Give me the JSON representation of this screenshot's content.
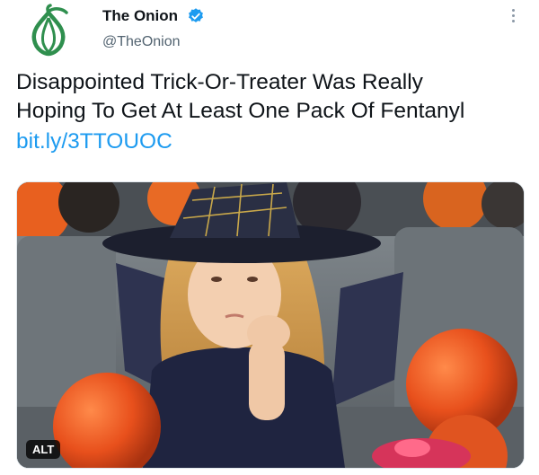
{
  "account": {
    "display_name": "The Onion",
    "handle": "@TheOnion",
    "verified": true,
    "avatar_icon": "onion-logo-icon",
    "brand_color": "#2f8f4e"
  },
  "tweet": {
    "text_lines": [
      "Disappointed Trick-Or-Treater Was Really",
      "Hoping To Get At Least One Pack Of Fentanyl"
    ],
    "link": "bit.ly/3TTOUOC"
  },
  "media": {
    "alt_label": "ALT"
  },
  "colors": {
    "link": "#1d9bf0",
    "verified": "#1d9bf0",
    "secondary_text": "#536471"
  }
}
